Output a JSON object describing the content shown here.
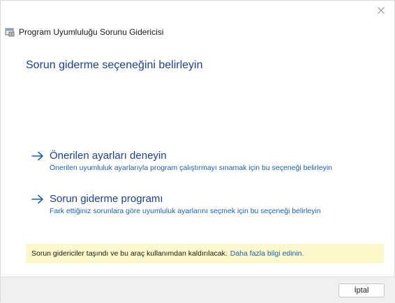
{
  "window": {
    "title": "Program Uyumluluğu Sorunu Gidericisi",
    "close_icon": "close-icon",
    "app_icon": "troubleshooter-icon"
  },
  "main": {
    "heading": "Sorun giderme seçeneğini belirleyin",
    "options": [
      {
        "label": "Önerilen ayarları deneyin",
        "description": "Önerilen uyumluluk ayarlarıyla program çalıştırmayı sınamak için bu seçeneği belirleyin",
        "icon": "arrow-right-icon"
      },
      {
        "label": "Sorun giderme programı",
        "description": "Fark ettiğiniz sorunlara göre uyumluluk ayarlarını seçmek için bu seçeneği belirleyin",
        "icon": "arrow-right-icon"
      }
    ],
    "notice": {
      "text": "Sorun gidericiler taşındı ve bu araç kullanımdan kaldırılacak.",
      "link": "Daha fazla bilgi edinin."
    }
  },
  "footer": {
    "cancel_label": "İptal"
  },
  "colors": {
    "heading": "#1c3f94",
    "link": "#1a5fb4",
    "notice_bg": "#fbf8cc",
    "footer_bg": "#f0f0f0"
  }
}
